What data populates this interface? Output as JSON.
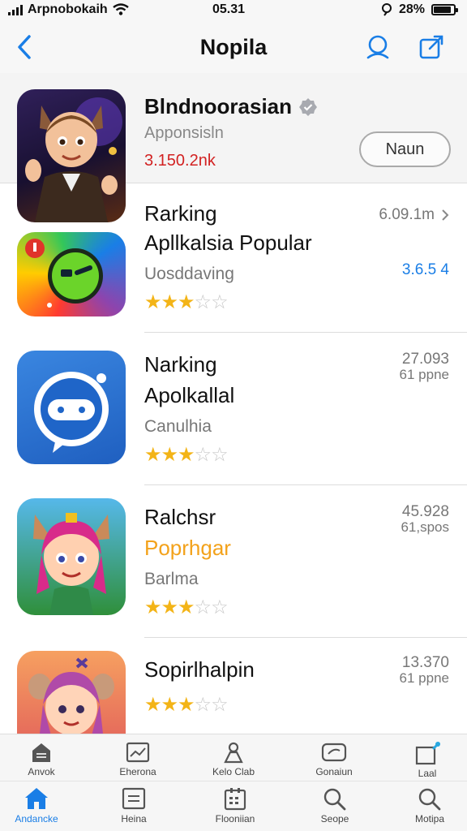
{
  "status_bar": {
    "carrier": "Arpnobokaih",
    "time": "05.31",
    "battery": "28%",
    "battery_level": 0.8
  },
  "nav": {
    "title": "Nopila"
  },
  "featured": {
    "name": "Blndnoorasian",
    "subtitle": "Apponsisln",
    "count": "3.150.2nk",
    "button_label": "Naun"
  },
  "list": [
    {
      "title": "Rarking",
      "subtitle": "Apllkalsia Popular",
      "category": "Uosddaving",
      "meta1": "6.09.1m",
      "meta2": "3.6.5 4",
      "rating": 3,
      "subtitle_color": "#111111",
      "meta2_color": "#1a7ee6"
    },
    {
      "title": "Narking",
      "subtitle": "Apolkallal",
      "category": "Canulhia",
      "meta1": "27.093",
      "meta2": "61 ppne",
      "rating": 2.5,
      "subtitle_color": "#111111",
      "meta2_color": "#777777"
    },
    {
      "title": "Ralchsr",
      "subtitle": "Poprhgar",
      "category": "Barlma",
      "meta1": "45.928",
      "meta2": "61,spos",
      "rating": 3,
      "subtitle_color": "#f3a21b",
      "meta2_color": "#777777"
    },
    {
      "title": "Sopirlhalpin",
      "subtitle": "",
      "category": "",
      "meta1": "13.370",
      "meta2": "61 ppne",
      "rating": 3,
      "subtitle_color": "#111111",
      "meta2_color": "#777777"
    }
  ],
  "tabbar_top": [
    "Anvok",
    "Eherona",
    "Kelo Clab",
    "Gonaiun",
    "Laal"
  ],
  "tabbar_bottom": [
    "Andancke",
    "Heina",
    "Flooniian",
    "Seope",
    "Motipa"
  ],
  "colors": {
    "accent": "#1a7ee6",
    "star": "#f3b417",
    "price_red": "#d22222"
  }
}
